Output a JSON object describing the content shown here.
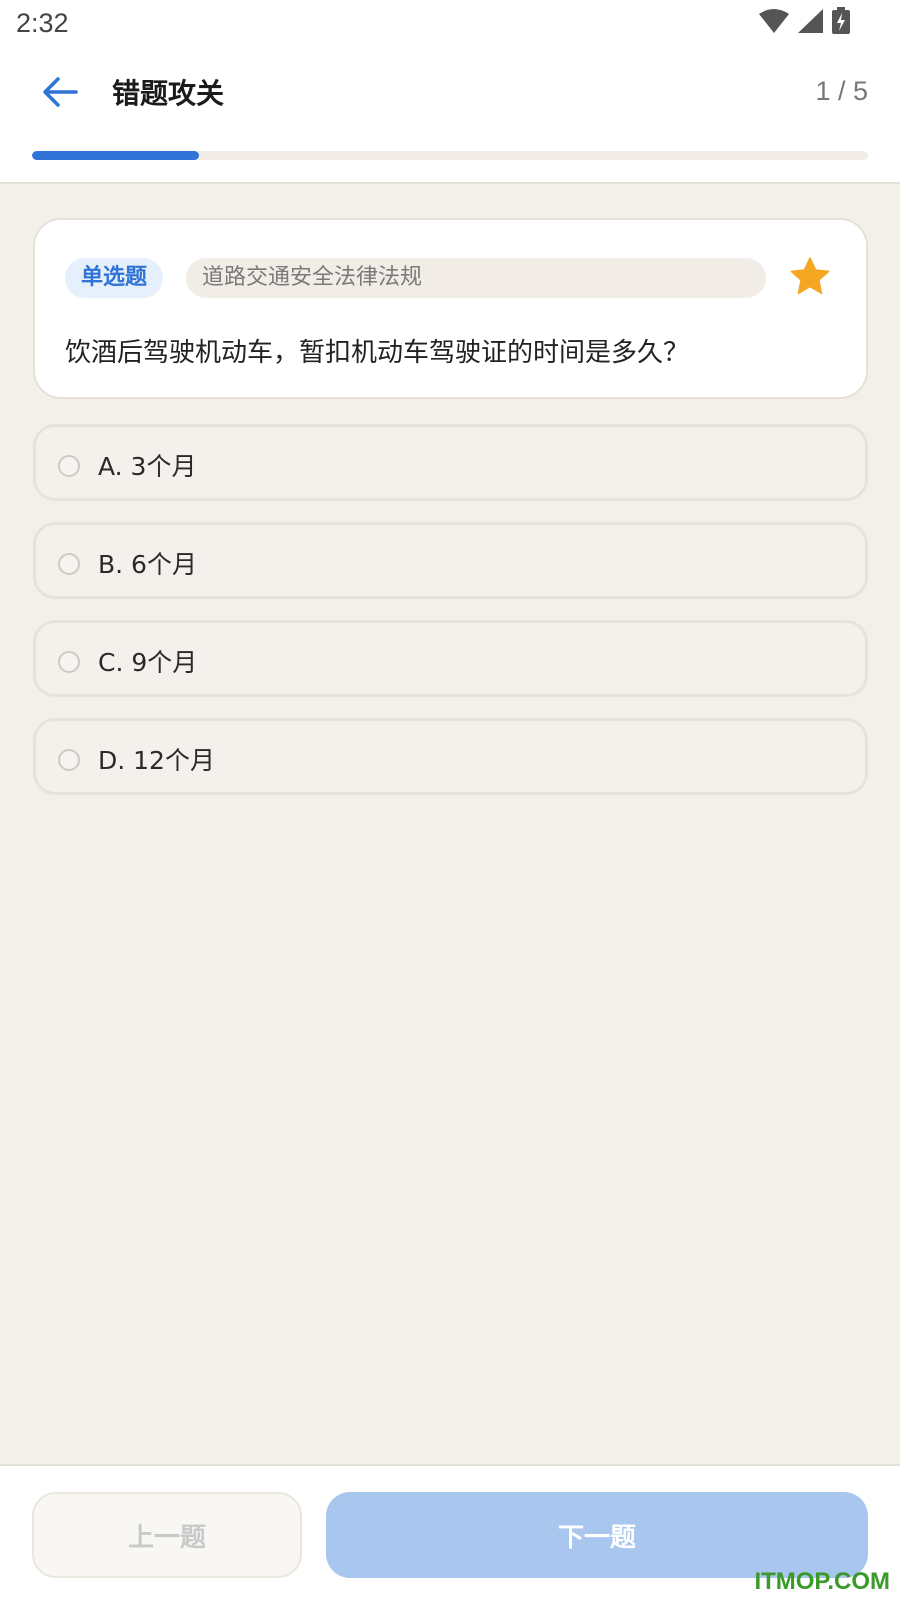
{
  "status_bar": {
    "time": "2:32",
    "icons": [
      "wifi-icon",
      "signal-icon",
      "battery-charging-icon"
    ]
  },
  "header": {
    "title": "错题攻关",
    "progress_text": "1 / 5",
    "progress_fraction": 0.2,
    "back_icon": "arrow-left-icon",
    "accent_color": "#2f73d6"
  },
  "question": {
    "type_label": "单选题",
    "category": "道路交通安全法律法规",
    "text": "饮酒后驾驶机动车，暂扣机动车驾驶证的时间是多久？",
    "favorite_icon": "star-icon",
    "favorite_color": "#f5a623"
  },
  "options": [
    {
      "label": "A. 3个月"
    },
    {
      "label": "B. 6个月"
    },
    {
      "label": "C. 9个月"
    },
    {
      "label": "D. 12个月"
    }
  ],
  "footer": {
    "prev_label": "上一题",
    "next_label": "下一题"
  },
  "watermark": "ITMOP.COM"
}
